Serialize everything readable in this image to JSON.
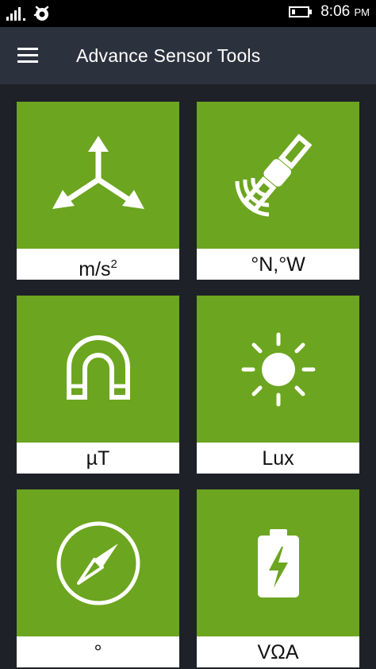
{
  "status_bar": {
    "time": "8:06",
    "ampm": "PM",
    "icons": [
      "signal-icon",
      "avast-icon",
      "battery-icon"
    ]
  },
  "app_bar": {
    "title": "Advance Sensor Tools",
    "menu_icon": "hamburger-menu-icon"
  },
  "colors": {
    "tile_green": "#6ca51f",
    "app_bar": "#2c323d",
    "background": "#1e2128",
    "status_bar": "#000000"
  },
  "tiles": [
    {
      "unit": "m/s",
      "superscript": "2",
      "icon": "axes-icon"
    },
    {
      "unit": "°N,°W",
      "icon": "satellite-icon"
    },
    {
      "unit": "µT",
      "icon": "magnet-icon"
    },
    {
      "unit": "Lux",
      "icon": "sun-icon"
    },
    {
      "unit": "°",
      "icon": "compass-icon"
    },
    {
      "unit": "VΩA",
      "icon": "battery-charging-icon"
    }
  ]
}
